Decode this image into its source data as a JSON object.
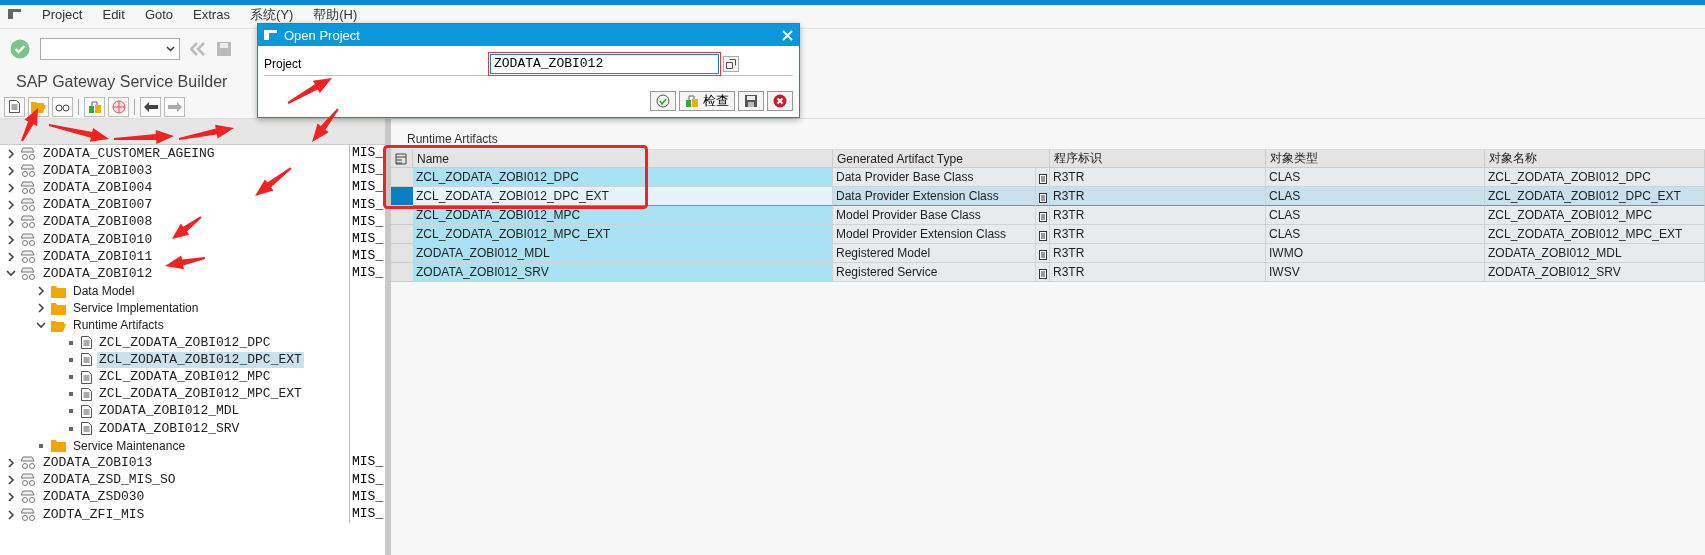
{
  "menu": [
    "Project",
    "Edit",
    "Goto",
    "Extras",
    "系统(Y)",
    "帮助(H)"
  ],
  "title": "SAP Gateway Service Builder",
  "tree": {
    "rows": [
      {
        "label": "ZODATA_CUSTOMER_AGEING",
        "column_2": "MIS_",
        "kind": "project",
        "expandable": true,
        "expanded": false,
        "selected": false
      },
      {
        "label": "ZODATA_ZOBI003",
        "column_2": "MIS_",
        "kind": "project",
        "expandable": true,
        "expanded": false,
        "selected": false
      },
      {
        "label": "ZODATA_ZOBI004",
        "column_2": "MIS_",
        "kind": "project",
        "expandable": true,
        "expanded": false,
        "selected": false
      },
      {
        "label": "ZODATA_ZOBI007",
        "column_2": "MIS_",
        "kind": "project",
        "expandable": true,
        "expanded": false,
        "selected": false
      },
      {
        "label": "ZODATA_ZOBI008",
        "column_2": "MIS_",
        "kind": "project",
        "expandable": true,
        "expanded": false,
        "selected": false
      },
      {
        "label": "ZODATA_ZOBI010",
        "column_2": "MIS_",
        "kind": "project",
        "expandable": true,
        "expanded": false,
        "selected": false
      },
      {
        "label": "ZODATA_ZOBI011",
        "column_2": "MIS_",
        "kind": "project",
        "expandable": true,
        "expanded": false,
        "selected": false
      },
      {
        "label": "ZODATA_ZOBI012",
        "column_2": "MIS_",
        "kind": "project",
        "expandable": true,
        "expanded": true,
        "selected": false,
        "children": [
          {
            "label": "Data Model",
            "kind": "folder",
            "expandable": true,
            "expanded": false,
            "selected": false
          },
          {
            "label": "Service Implementation",
            "kind": "folder",
            "expandable": true,
            "expanded": false,
            "selected": false
          },
          {
            "label": "Runtime Artifacts",
            "kind": "folder",
            "expandable": true,
            "expanded": true,
            "selected": false,
            "children": [
              {
                "label": "ZCL_ZODATA_ZOBI012_DPC",
                "kind": "file",
                "expandable": false,
                "selected": false
              },
              {
                "label": "ZCL_ZODATA_ZOBI012_DPC_EXT",
                "kind": "file",
                "expandable": false,
                "selected": true
              },
              {
                "label": "ZCL_ZODATA_ZOBI012_MPC",
                "kind": "file",
                "expandable": false,
                "selected": false
              },
              {
                "label": "ZCL_ZODATA_ZOBI012_MPC_EXT",
                "kind": "file",
                "expandable": false,
                "selected": false
              },
              {
                "label": "ZODATA_ZOBI012_MDL",
                "kind": "file",
                "expandable": false,
                "selected": false
              },
              {
                "label": "ZODATA_ZOBI012_SRV",
                "kind": "file",
                "expandable": false,
                "selected": false
              }
            ]
          },
          {
            "label": "Service Maintenance",
            "kind": "folder",
            "expandable": false,
            "selected": false
          }
        ]
      },
      {
        "label": "ZODATA_ZOBI013",
        "column_2": "MIS_",
        "kind": "project",
        "expandable": true,
        "expanded": false,
        "selected": false
      },
      {
        "label": "ZODATA_ZSD_MIS_SO",
        "column_2": "MIS_",
        "kind": "project",
        "expandable": true,
        "expanded": false,
        "selected": false
      },
      {
        "label": "ZODATA_ZSD030",
        "column_2": "MIS_",
        "kind": "project",
        "expandable": true,
        "expanded": false,
        "selected": false
      },
      {
        "label": "ZODTA_ZFI_MIS",
        "column_2": "MIS_",
        "kind": "project",
        "expandable": true,
        "expanded": false,
        "selected": false
      }
    ]
  },
  "section_title": "Runtime Artifacts",
  "table": {
    "columns": [
      "Name",
      "Generated Artifact Type",
      "程序标识",
      "对象类型",
      "对象名称"
    ],
    "rows": [
      {
        "selected": false,
        "cells": [
          "ZCL_ZODATA_ZOBI012_DPC",
          "Data Provider Base Class",
          "R3TR",
          "CLAS",
          "ZCL_ZODATA_ZOBI012_DPC"
        ]
      },
      {
        "selected": true,
        "cells": [
          "ZCL_ZODATA_ZOBI012_DPC_EXT",
          "Data Provider Extension Class",
          "R3TR",
          "CLAS",
          "ZCL_ZODATA_ZOBI012_DPC_EXT"
        ]
      },
      {
        "selected": false,
        "cells": [
          "ZCL_ZODATA_ZOBI012_MPC",
          "Model Provider Base Class",
          "R3TR",
          "CLAS",
          "ZCL_ZODATA_ZOBI012_MPC"
        ]
      },
      {
        "selected": false,
        "cells": [
          "ZCL_ZODATA_ZOBI012_MPC_EXT",
          "Model Provider Extension Class",
          "R3TR",
          "CLAS",
          "ZCL_ZODATA_ZOBI012_MPC_EXT"
        ]
      },
      {
        "selected": false,
        "cells": [
          "ZODATA_ZOBI012_MDL",
          "Registered Model",
          "R3TR",
          "IWMO",
          "ZODATA_ZOBI012_MDL"
        ]
      },
      {
        "selected": false,
        "cells": [
          "ZODATA_ZOBI012_SRV",
          "Registered Service",
          "R3TR",
          "IWSV",
          "ZODATA_ZOBI012_SRV"
        ]
      }
    ]
  },
  "dialog": {
    "title": "Open Project",
    "field_label": "Project",
    "value": "ZODATA_ZOBI012",
    "buttons": [
      {
        "kind": "continue"
      },
      {
        "kind": "check",
        "label": "检查"
      },
      {
        "kind": "save"
      },
      {
        "kind": "cancel"
      }
    ]
  }
}
